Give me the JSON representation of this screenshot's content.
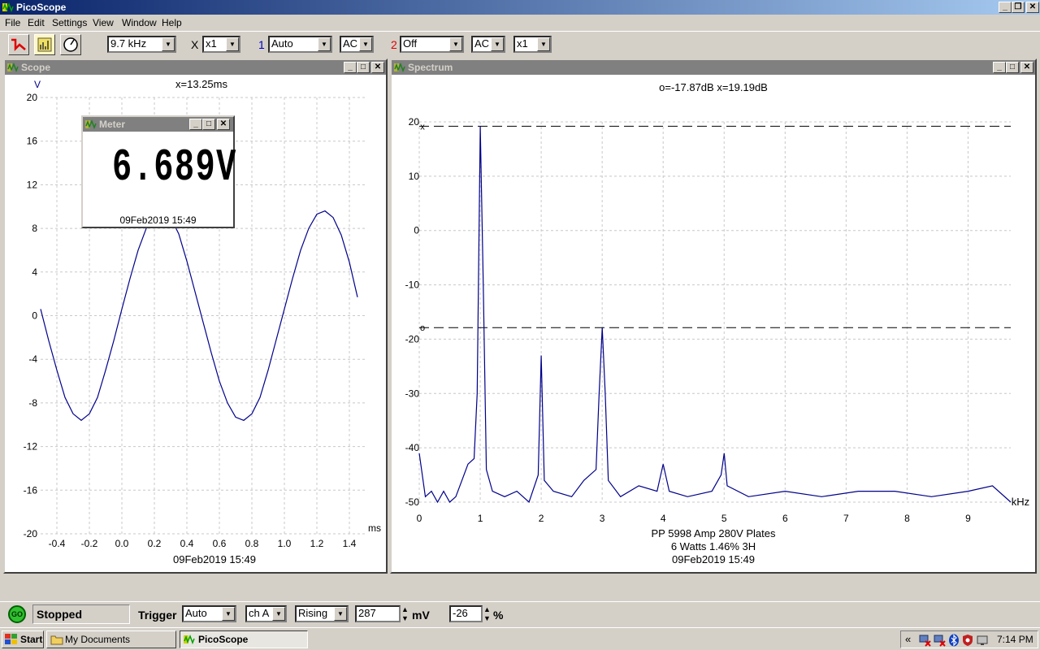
{
  "app": {
    "title": "PicoScope"
  },
  "menu": [
    "File",
    "Edit",
    "Settings",
    "View",
    "Window",
    "Help"
  ],
  "toolbar": {
    "timebase": "9.7 kHz",
    "x_label": "X",
    "x_mult": "x1",
    "ch1_num": "1",
    "ch1_range": "Auto",
    "ch1_coupling": "AC",
    "ch2_num": "2",
    "ch2_range": "Off",
    "ch2_coupling": "AC",
    "ch2_mult": "x1"
  },
  "scope": {
    "title": "Scope",
    "cursor_readout": "x=13.25ms",
    "y_unit": "V",
    "x_unit": "ms",
    "timestamp": "09Feb2019  15:49"
  },
  "meter": {
    "title": "Meter",
    "reading": "6.689V",
    "timestamp": "09Feb2019  15:49"
  },
  "spectrum": {
    "title": "Spectrum",
    "cursor_readout": "o=-17.87dB  x=19.19dB",
    "x_unit": "kHz",
    "notes": [
      "PP 5998  Amp 280V Plates",
      "6 Watts 1.46% 3H",
      "09Feb2019  15:49"
    ]
  },
  "status": {
    "go_label": "GO",
    "state": "Stopped",
    "trigger_label": "Trigger",
    "trigger_mode": "Auto",
    "trigger_channel": "ch A",
    "trigger_edge": "Rising",
    "trigger_level": "287",
    "level_unit": "mV",
    "pretrigger": "-26",
    "pretrigger_unit": "%"
  },
  "taskbar": {
    "start": "Start",
    "items": [
      "My Documents",
      "PicoScope"
    ],
    "tray_chevron": "«",
    "clock": "7:14 PM"
  },
  "chart_data": [
    {
      "type": "line",
      "title": "",
      "xlabel": "ms",
      "ylabel": "V",
      "xlim": [
        -0.5,
        1.5
      ],
      "ylim": [
        -20,
        20
      ],
      "x_ticks": [
        -0.4,
        -0.2,
        0.0,
        0.2,
        0.4,
        0.6,
        0.8,
        1.0,
        1.2,
        1.4
      ],
      "y_ticks": [
        20,
        16,
        12,
        8,
        4,
        0,
        -4,
        -8,
        -12,
        -16,
        -20
      ],
      "grid": true,
      "series": [
        {
          "color": "#00008b",
          "x": [
            -0.5,
            -0.45,
            -0.4,
            -0.35,
            -0.3,
            -0.25,
            -0.2,
            -0.15,
            -0.1,
            -0.05,
            0.0,
            0.05,
            0.1,
            0.15,
            0.2,
            0.25,
            0.3,
            0.35,
            0.4,
            0.45,
            0.5,
            0.55,
            0.6,
            0.65,
            0.7,
            0.75,
            0.8,
            0.85,
            0.9,
            0.95,
            1.0,
            1.05,
            1.1,
            1.15,
            1.2,
            1.25,
            1.3,
            1.35,
            1.4,
            1.45
          ],
          "y": [
            0.6,
            -2.3,
            -5.0,
            -7.5,
            -9.0,
            -9.6,
            -9.0,
            -7.5,
            -5.0,
            -2.3,
            0.6,
            3.4,
            6.0,
            8.0,
            9.3,
            9.6,
            9.0,
            7.5,
            5.0,
            2.2,
            -0.6,
            -3.4,
            -6.0,
            -8.0,
            -9.3,
            -9.6,
            -9.0,
            -7.5,
            -5.0,
            -2.2,
            0.6,
            3.4,
            6.0,
            8.0,
            9.3,
            9.6,
            9.0,
            7.4,
            4.9,
            1.7
          ]
        }
      ]
    },
    {
      "type": "line",
      "title": "",
      "xlabel": "kHz",
      "ylabel": "",
      "xlim": [
        0,
        9.7
      ],
      "ylim": [
        -50,
        20
      ],
      "x_ticks": [
        0,
        1,
        2,
        3,
        4,
        5,
        6,
        7,
        8,
        9
      ],
      "y_ticks": [
        20,
        10,
        0,
        -10,
        -20,
        -30,
        -40,
        -50
      ],
      "grid": true,
      "cursors": [
        {
          "label": "x",
          "value": 19.19
        },
        {
          "label": "o",
          "value": -17.87
        }
      ],
      "series": [
        {
          "color": "#00008b",
          "x": [
            0.0,
            0.1,
            0.2,
            0.3,
            0.4,
            0.5,
            0.6,
            0.7,
            0.8,
            0.9,
            0.95,
            1.0,
            1.05,
            1.1,
            1.2,
            1.4,
            1.6,
            1.8,
            1.95,
            2.0,
            2.05,
            2.2,
            2.5,
            2.7,
            2.9,
            2.95,
            3.0,
            3.05,
            3.1,
            3.3,
            3.6,
            3.9,
            4.0,
            4.1,
            4.4,
            4.8,
            4.95,
            5.0,
            5.05,
            5.4,
            6.0,
            6.6,
            7.2,
            7.8,
            8.4,
            9.0,
            9.4,
            9.7
          ],
          "y": [
            -41,
            -49,
            -48,
            -50,
            -48,
            -50,
            -49,
            -46,
            -43,
            -42,
            -30,
            19.19,
            -10,
            -44,
            -48,
            -49,
            -48,
            -50,
            -45,
            -23,
            -46,
            -48,
            -49,
            -46,
            -44,
            -30,
            -17.87,
            -30,
            -46,
            -49,
            -47,
            -48,
            -43,
            -48,
            -49,
            -48,
            -45,
            -41,
            -47,
            -49,
            -48,
            -49,
            -48,
            -48,
            -49,
            -48,
            -47,
            -50
          ]
        }
      ]
    }
  ]
}
